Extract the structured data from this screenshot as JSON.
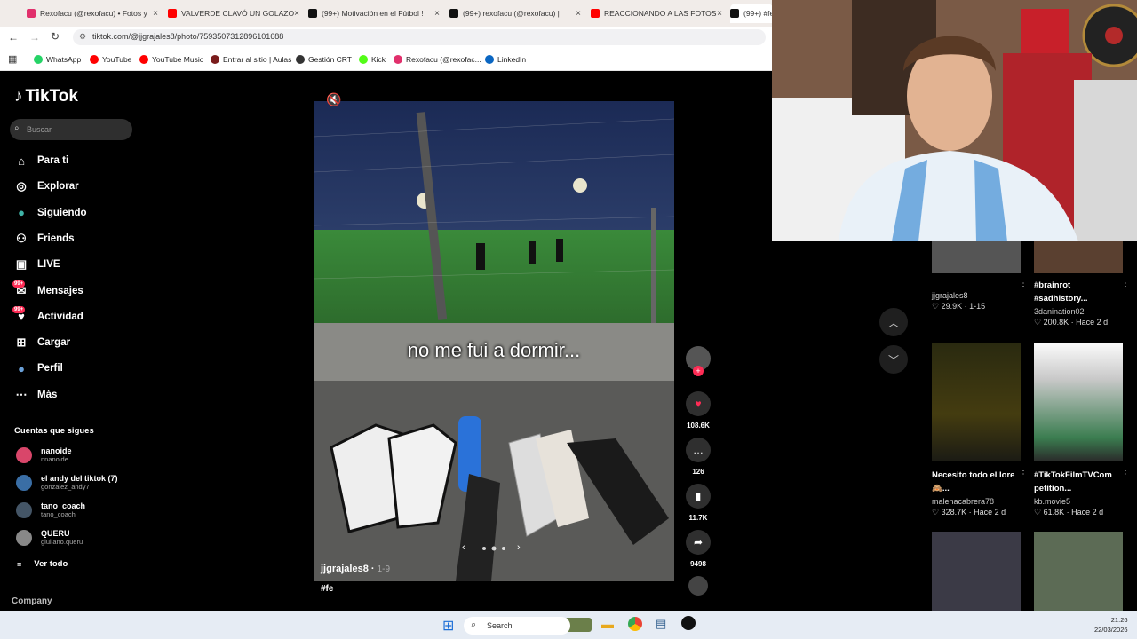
{
  "browser": {
    "tabs": [
      {
        "label": "Rexofacu (@rexofacu) • Fotos y",
        "color": "#e1306c"
      },
      {
        "label": "VALVERDE CLAVÓ UN GOLAZO",
        "color": "#ff0000"
      },
      {
        "label": "(99+) Motivación en el Fútbol !",
        "color": "#111111"
      },
      {
        "label": "(99+) rexofacu (@rexofacu) |",
        "color": "#111111"
      },
      {
        "label": "REACCIONANDO A LAS FOTOS",
        "color": "#ff0000"
      },
      {
        "label": "(99+) #fe",
        "color": "#111111"
      }
    ],
    "url": "tiktok.com/@jjgrajales8/photo/7593507312896101688",
    "bookmarks": [
      {
        "label": "WhatsApp",
        "color": "#25d366"
      },
      {
        "label": "YouTube",
        "color": "#ff0000"
      },
      {
        "label": "YouTube Music",
        "color": "#ff0000"
      },
      {
        "label": "Entrar al sitio | Aulas",
        "color": "#7a1c1c"
      },
      {
        "label": "Gestión CRT",
        "color": "#333333"
      },
      {
        "label": "Kick",
        "color": "#53fc18"
      },
      {
        "label": "Rexofacu (@rexofac...",
        "color": "#e1306c"
      },
      {
        "label": "LinkedIn",
        "color": "#0a66c2"
      }
    ]
  },
  "tiktok": {
    "brand": "TikTok",
    "search_placeholder": "Buscar",
    "nav": [
      {
        "label": "Para ti",
        "icon": "home-icon"
      },
      {
        "label": "Explorar",
        "icon": "compass-icon"
      },
      {
        "label": "Siguiendo",
        "icon": "following-icon"
      },
      {
        "label": "Friends",
        "icon": "friends-icon"
      },
      {
        "label": "LIVE",
        "icon": "live-icon"
      },
      {
        "label": "Mensajes",
        "icon": "messages-icon",
        "badge": "99+"
      },
      {
        "label": "Actividad",
        "icon": "activity-icon",
        "badge": "99+"
      },
      {
        "label": "Cargar",
        "icon": "upload-icon"
      },
      {
        "label": "Perfil",
        "icon": "profile-icon"
      },
      {
        "label": "Más",
        "icon": "more-icon"
      }
    ],
    "following_title": "Cuentas que sigues",
    "following": [
      {
        "name": "nanoide",
        "handle": "nnanoide",
        "color": "#d9466a"
      },
      {
        "name": "el andy del tiktok (7)",
        "handle": "gonzalez_andy7",
        "color": "#3a6ea5"
      },
      {
        "name": "tano_coach",
        "handle": "tano_coach",
        "color": "#445566"
      },
      {
        "name": "QUERU",
        "handle": "giuliano.queru",
        "color": "#888888"
      }
    ],
    "see_all": "Ver todo",
    "company": "Company",
    "post": {
      "caption_overlay": "no me fui a dormir...",
      "author": "jjgrajales8",
      "date": "1-9",
      "hashtag": "#fe",
      "likes": "108.6K",
      "comments": "126",
      "saves": "11.7K",
      "shares": "9498"
    },
    "grid": [
      {
        "title": "",
        "user": "jjgrajales8",
        "stats": "29.9K · 1-15"
      },
      {
        "title": "#brainrot #sadhistory...",
        "user": "3danination02",
        "stats": "200.8K · Hace 2 d"
      },
      {
        "title": "Necesito todo el lore 🙈...",
        "user": "malenacabrera78",
        "stats": "328.7K · Hace 2 d"
      },
      {
        "title": "#TikTokFilmTVCom petition...",
        "user": "kb.movie5",
        "stats": "61.8K · Hace 2 d"
      }
    ]
  },
  "taskbar": {
    "search": "Search",
    "time": "21:26",
    "date": "22/03/2026"
  }
}
